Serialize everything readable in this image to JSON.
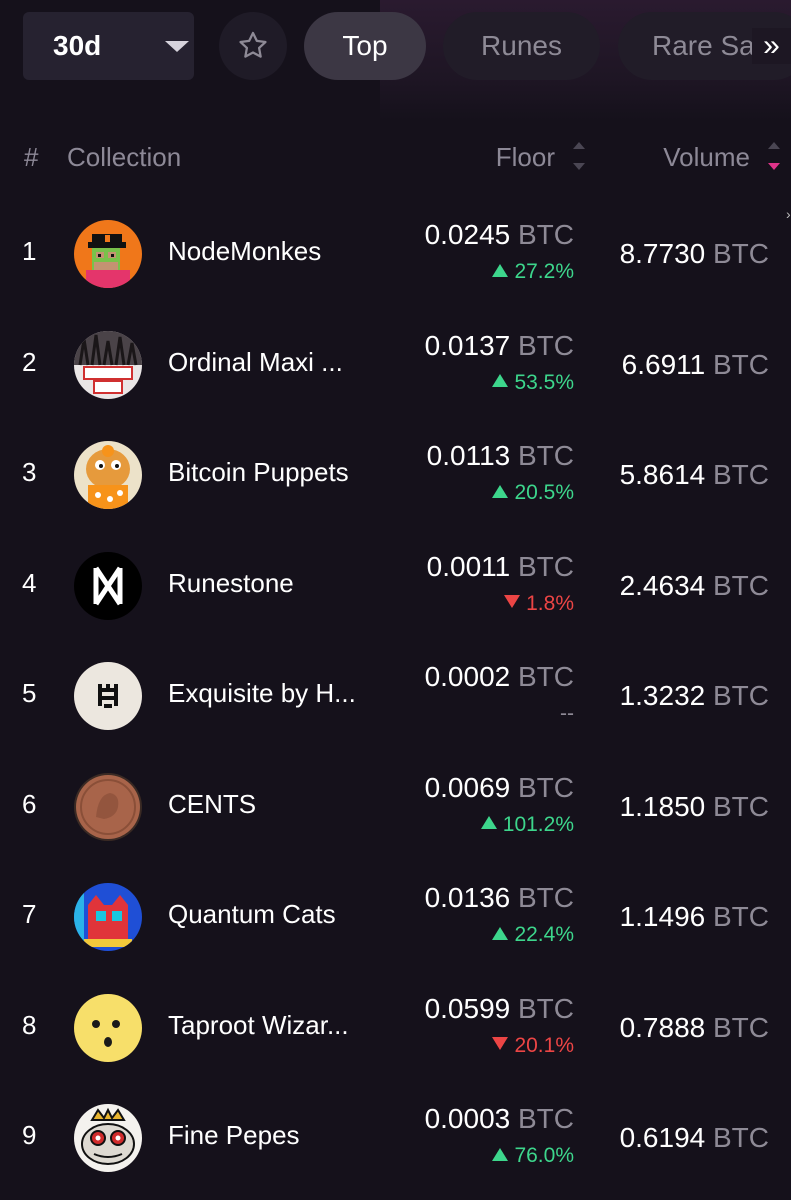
{
  "filters": {
    "period": "30d",
    "favorites_icon": "star-icon",
    "tabs": [
      {
        "label": "Top",
        "active": true
      },
      {
        "label": "Runes",
        "active": false
      },
      {
        "label": "Rare Sa",
        "active": false
      }
    ],
    "more_label": "»"
  },
  "table": {
    "headers": {
      "rank": "#",
      "collection": "Collection",
      "floor": "Floor",
      "volume": "Volume"
    },
    "rows": [
      {
        "rank": "1",
        "name": "NodeMonkes",
        "floor": "0.0245",
        "unit": "BTC",
        "change": "27.2%",
        "trend": "up",
        "volume": "8.7730",
        "avatar_icon": "nodemonkes-avatar"
      },
      {
        "rank": "2",
        "name": "Ordinal Maxi ...",
        "floor": "0.0137",
        "unit": "BTC",
        "change": "53.5%",
        "trend": "up",
        "volume": "6.6911",
        "avatar_icon": "ordinal-maxi-avatar"
      },
      {
        "rank": "3",
        "name": "Bitcoin Puppets",
        "floor": "0.0113",
        "unit": "BTC",
        "change": "20.5%",
        "trend": "up",
        "volume": "5.8614",
        "avatar_icon": "bitcoin-puppets-avatar"
      },
      {
        "rank": "4",
        "name": "Runestone",
        "floor": "0.0011",
        "unit": "BTC",
        "change": "1.8%",
        "trend": "down",
        "volume": "2.4634",
        "avatar_icon": "runestone-avatar"
      },
      {
        "rank": "5",
        "name": "Exquisite by H...",
        "floor": "0.0002",
        "unit": "BTC",
        "change": "--",
        "trend": "flat",
        "volume": "1.3232",
        "avatar_icon": "exquisite-avatar"
      },
      {
        "rank": "6",
        "name": "CENTS",
        "floor": "0.0069",
        "unit": "BTC",
        "change": "101.2%",
        "trend": "up",
        "volume": "1.1850",
        "avatar_icon": "cents-avatar"
      },
      {
        "rank": "7",
        "name": "Quantum Cats",
        "floor": "0.0136",
        "unit": "BTC",
        "change": "22.4%",
        "trend": "up",
        "volume": "1.1496",
        "avatar_icon": "quantum-cats-avatar"
      },
      {
        "rank": "8",
        "name": "Taproot Wizar...",
        "floor": "0.0599",
        "unit": "BTC",
        "change": "20.1%",
        "trend": "down",
        "volume": "0.7888",
        "avatar_icon": "taproot-wizards-avatar"
      },
      {
        "rank": "9",
        "name": "Fine Pepes",
        "floor": "0.0003",
        "unit": "BTC",
        "change": "76.0%",
        "trend": "up",
        "volume": "0.6194",
        "avatar_icon": "fine-pepes-avatar"
      }
    ]
  },
  "colors": {
    "background": "#15111b",
    "positive": "#3dd68c",
    "negative": "#ec4545",
    "muted": "#8e8a96",
    "active_sort": "#e0338a"
  }
}
